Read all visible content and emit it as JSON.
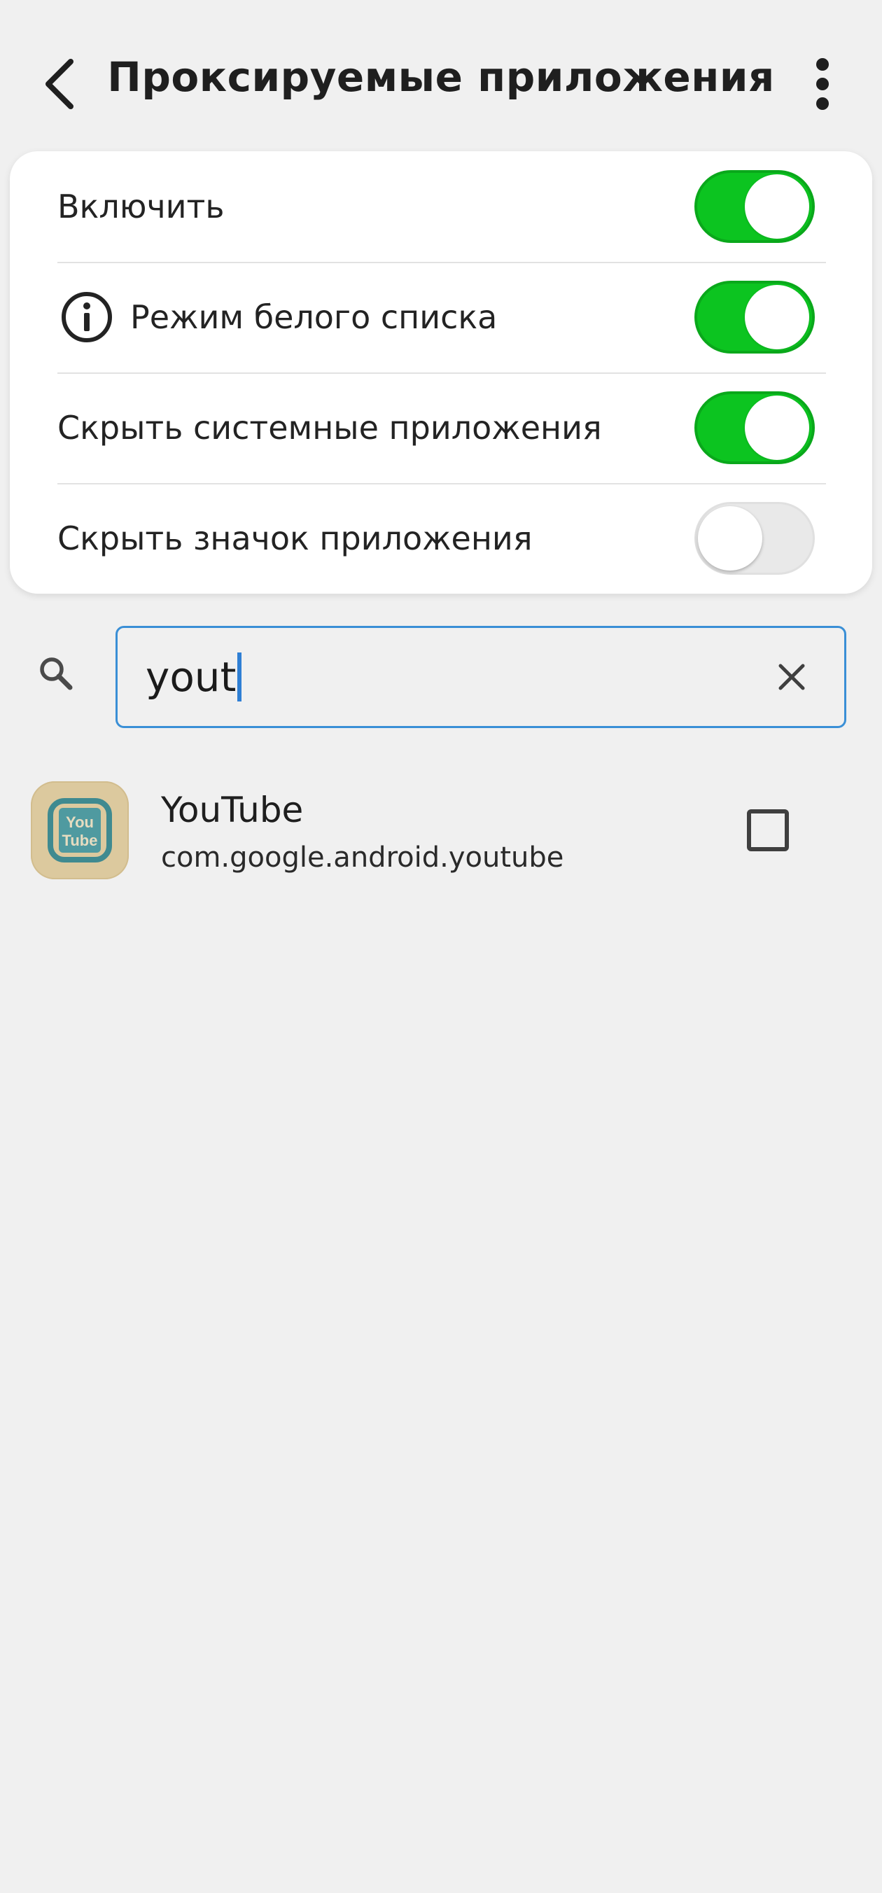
{
  "header": {
    "title": "Проксируемые приложения",
    "back_icon": "arrow-back-icon",
    "more_icon": "more-vert-icon"
  },
  "settings": [
    {
      "label": "Включить",
      "enabled": true,
      "icon": null
    },
    {
      "label": "Режим белого списка",
      "enabled": true,
      "icon": "info-icon"
    },
    {
      "label": "Скрыть системные приложения",
      "enabled": true,
      "icon": null
    },
    {
      "label": "Скрыть значок приложения",
      "enabled": false,
      "icon": null
    }
  ],
  "search": {
    "value": "yout",
    "icon": "search-icon",
    "clear_icon": "close-icon"
  },
  "apps": [
    {
      "name": "YouTube",
      "package": "com.google.android.youtube",
      "checked": false,
      "icon_text": [
        "You",
        "Tube"
      ]
    }
  ],
  "colors": {
    "toggle_on": "#0cc420",
    "toggle_off": "#e9e9e9",
    "search_border": "#3a8fd6",
    "background": "#f0f0f0",
    "app_icon_bg": "#dcc99e",
    "app_icon_fg": "#3f8a90"
  }
}
